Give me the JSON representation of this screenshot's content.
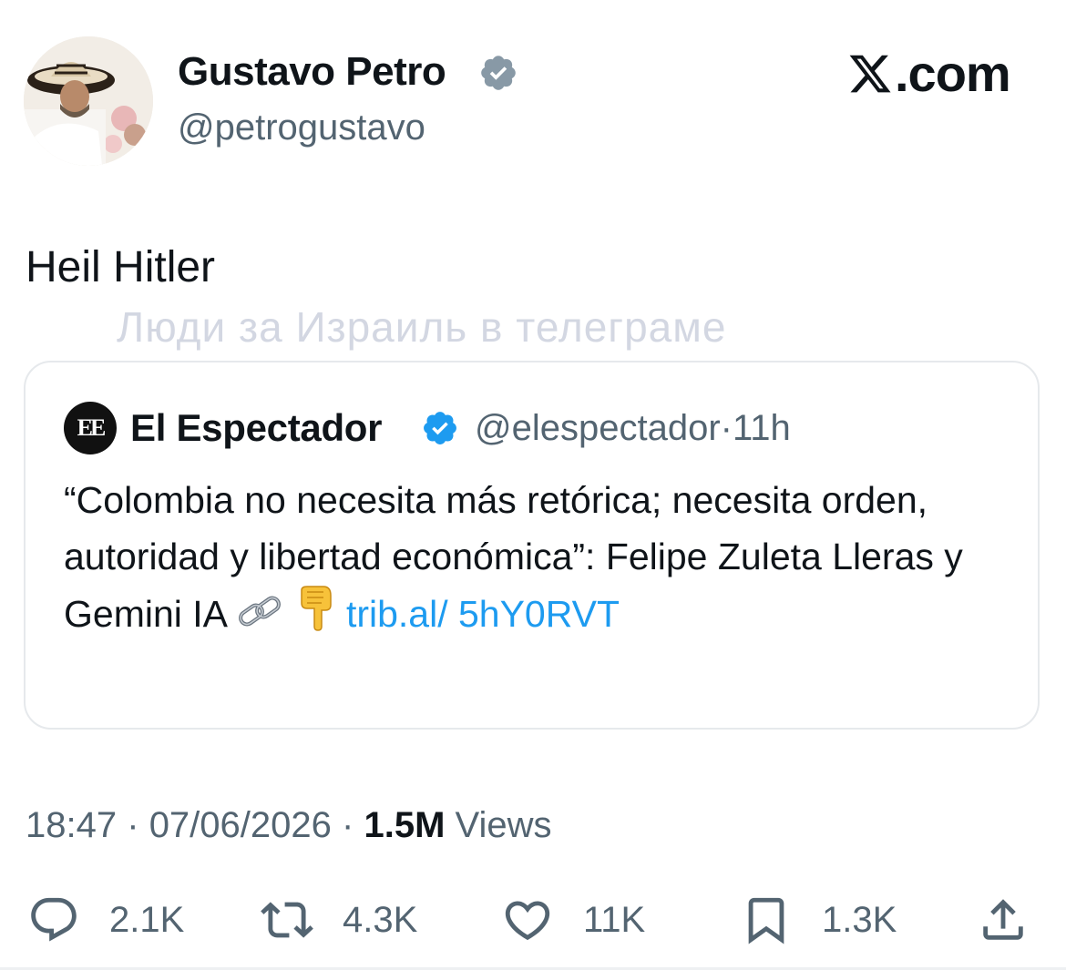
{
  "author": {
    "name": "Gustavo Petro",
    "handle": "@petrogustavo",
    "verified": true
  },
  "brand": {
    "logo_text": ".com"
  },
  "tweet": {
    "text": "Heil Hitler"
  },
  "watermark": "Люди за Израиль в телеграме",
  "quote": {
    "logo_text": "EE",
    "name": "El Espectador",
    "handle": "@elespectador",
    "time": "11h",
    "separator": "·",
    "text": "“Colombia no necesita más retórica; necesita orden, autoridad y libertad económica”: Felipe Zuleta Lleras y Gemini IA ",
    "link": "trib.al/ 5hY0RVT"
  },
  "meta": {
    "time": "18:47",
    "date": "07/06/2026",
    "separator": "·",
    "views_count": "1.5M",
    "views_label": "Views"
  },
  "actions": {
    "replies": "2.1K",
    "reposts": "4.3K",
    "likes": "11K",
    "bookmarks": "1.3K"
  },
  "colors": {
    "text": "#0f1419",
    "secondary": "#536471",
    "link": "#1d9bf0",
    "verified": "#1d9bf0",
    "watermark": "#d3d7e2"
  }
}
